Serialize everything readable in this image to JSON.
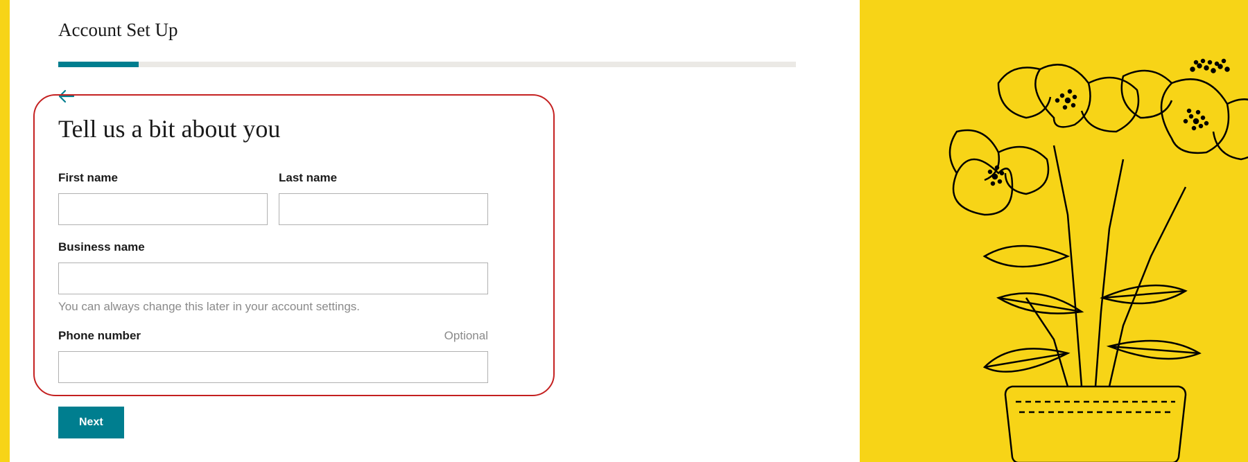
{
  "header": {
    "title": "Account Set Up"
  },
  "progress": {
    "percent": 11
  },
  "form": {
    "heading": "Tell us a bit about you",
    "first_name_label": "First name",
    "first_name_value": "",
    "last_name_label": "Last name",
    "last_name_value": "",
    "business_name_label": "Business name",
    "business_name_value": "",
    "business_name_helper": "You can always change this later in your account settings.",
    "phone_label": "Phone number",
    "phone_optional": "Optional",
    "phone_value": "",
    "next_button": "Next"
  }
}
